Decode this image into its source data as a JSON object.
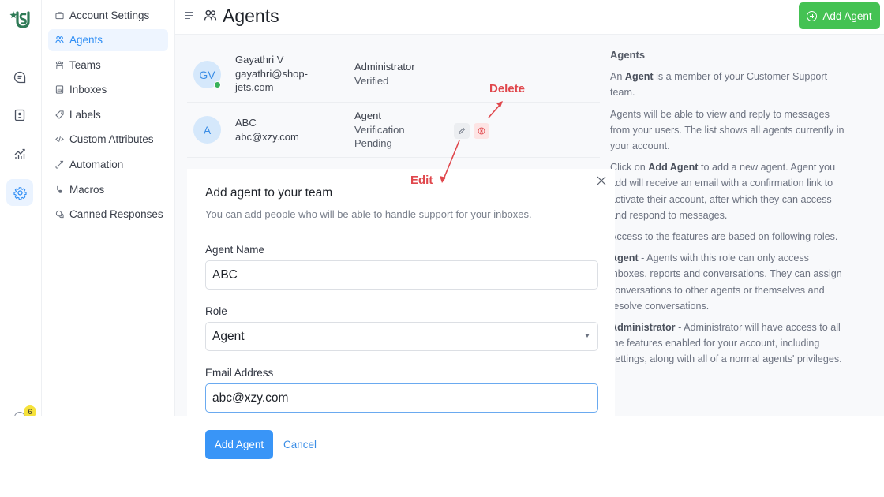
{
  "rail": {
    "items": [
      {
        "icon": "chat-icon"
      },
      {
        "icon": "contacts-icon"
      },
      {
        "icon": "reports-icon"
      },
      {
        "icon": "settings-icon",
        "active": true
      }
    ],
    "notification_count": "6"
  },
  "sidebar": {
    "items": [
      {
        "label": "Account Settings",
        "icon": "briefcase-icon"
      },
      {
        "label": "Agents",
        "icon": "people-icon",
        "active": true
      },
      {
        "label": "Teams",
        "icon": "team-icon"
      },
      {
        "label": "Inboxes",
        "icon": "inbox-icon"
      },
      {
        "label": "Labels",
        "icon": "tag-icon"
      },
      {
        "label": "Custom Attributes",
        "icon": "code-icon"
      },
      {
        "label": "Automation",
        "icon": "automation-icon"
      },
      {
        "label": "Macros",
        "icon": "macros-icon"
      },
      {
        "label": "Canned Responses",
        "icon": "chat-bubbles-icon"
      }
    ]
  },
  "header": {
    "title": "Agents",
    "add_button": "Add Agent"
  },
  "agents": [
    {
      "initials": "GV",
      "name": "Gayathri V",
      "email_line1": "gayathri@shop-",
      "email_line2": "jets.com",
      "role": "Administrator",
      "status": "Verified",
      "online": true
    },
    {
      "initials": "A",
      "name": "ABC",
      "email": "abc@xzy.com",
      "role": "Agent",
      "status_line1": "Verification",
      "status_line2": "Pending"
    }
  ],
  "annotations": {
    "delete": "Delete",
    "edit": "Edit",
    "color": "#e0474c"
  },
  "info": {
    "title": "Agents",
    "p1_pre": "An ",
    "p1_bold": "Agent",
    "p1_post": " is a member of your Customer Support team.",
    "p2": "Agents will be able to view and reply to messages from your users. The list shows all agents currently in your account.",
    "p3_pre": "Click on ",
    "p3_bold": "Add Agent",
    "p3_post": " to add a new agent. Agent you add will receive an email with a confirmation link to activate their account, after which they can access and respond to messages.",
    "p4": "Access to the features are based on following roles.",
    "p5_bold": "Agent",
    "p5_post": " - Agents with this role can only access inboxes, reports and conversations. They can assign conversations to other agents or themselves and resolve conversations.",
    "p6_bold": "Administrator",
    "p6_post": " - Administrator will have access to all the features enabled for your account, including settings, along with all of a normal agents' privileges."
  },
  "modal": {
    "title": "Add agent to your team",
    "description": "You can add people who will be able to handle support for your inboxes.",
    "name_label": "Agent Name",
    "name_value": "ABC",
    "role_label": "Role",
    "role_value": "Agent",
    "email_label": "Email Address",
    "email_value": "abc@xzy.com",
    "submit": "Add Agent",
    "cancel": "Cancel"
  },
  "colors": {
    "primary": "#3995f7",
    "success": "#44c253",
    "danger": "#e0474c",
    "brand": "#2e7a56"
  }
}
